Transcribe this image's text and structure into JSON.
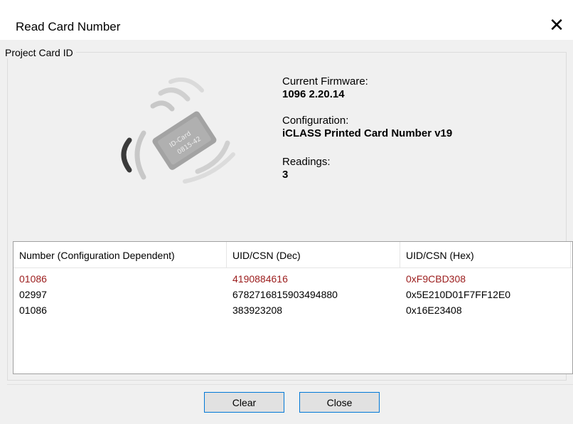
{
  "window": {
    "title": "Read Card Number",
    "close_glyph": "✕"
  },
  "group": {
    "label": "Project Card ID"
  },
  "illustration": {
    "card_line1": "ID-Card",
    "card_line2": "0815-42"
  },
  "info": {
    "firmware_label": "Current Firmware:",
    "firmware_value": "1096  2.20.14",
    "config_label": "Configuration:",
    "config_value": "iCLASS Printed Card Number v19",
    "readings_label": "Readings:",
    "readings_value": "3"
  },
  "table": {
    "columns": [
      "Number (Configuration Dependent)",
      "UID/CSN (Dec)",
      "UID/CSN (Hex)"
    ],
    "rows": [
      {
        "number": "01086",
        "dec": "4190884616",
        "hex": "0xF9CBD308",
        "selected": true
      },
      {
        "number": "02997",
        "dec": "6782716815903494880",
        "hex": "0x5E210D01F7FF12E0",
        "selected": false
      },
      {
        "number": "01086",
        "dec": "383923208",
        "hex": "0x16E23408",
        "selected": false
      }
    ],
    "selected_color": "#9b1c1c"
  },
  "buttons": {
    "clear": "Clear",
    "close": "Close"
  },
  "colors": {
    "button_border": "#0078d7",
    "client_bg": "#f0f0f0"
  }
}
